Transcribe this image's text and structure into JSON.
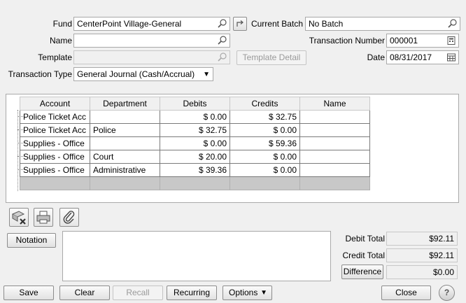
{
  "header": {
    "fund_label": "Fund",
    "fund_value": "CenterPoint Village-General",
    "name_label": "Name",
    "name_value": "",
    "template_label": "Template",
    "template_value": "",
    "template_detail_label": "Template Detail",
    "transaction_type_label": "Transaction Type",
    "transaction_type_value": "General Journal (Cash/Accrual)",
    "current_batch_label": "Current Batch",
    "current_batch_value": "No Batch",
    "transaction_number_label": "Transaction Number",
    "transaction_number_value": "000001",
    "date_label": "Date",
    "date_value": "08/31/2017"
  },
  "grid": {
    "columns": [
      "Account",
      "Department",
      "Debits",
      "Credits",
      "Name"
    ],
    "rows": [
      {
        "account": "Police Ticket Acc",
        "department": "",
        "debits": "$ 0.00",
        "credits": "$ 32.75",
        "name": ""
      },
      {
        "account": "Police Ticket Acc",
        "department": "Police",
        "debits": "$ 32.75",
        "credits": "$ 0.00",
        "name": ""
      },
      {
        "account": "Supplies - Office",
        "department": "",
        "debits": "$ 0.00",
        "credits": "$ 59.36",
        "name": ""
      },
      {
        "account": "Supplies - Office",
        "department": "Court",
        "debits": "$ 20.00",
        "credits": "$ 0.00",
        "name": ""
      },
      {
        "account": "Supplies - Office",
        "department": "Administrative",
        "debits": "$ 39.36",
        "credits": "$ 0.00",
        "name": ""
      }
    ]
  },
  "notation": {
    "button_label": "Notation",
    "text": ""
  },
  "totals": {
    "debit_label": "Debit Total",
    "debit_value": "$92.11",
    "credit_label": "Credit Total",
    "credit_value": "$92.11",
    "difference_label": "Difference",
    "difference_value": "$0.00"
  },
  "footer": {
    "save": "Save",
    "clear": "Clear",
    "recall": "Recall",
    "recurring": "Recurring",
    "options": "Options",
    "close": "Close",
    "help": "?"
  }
}
